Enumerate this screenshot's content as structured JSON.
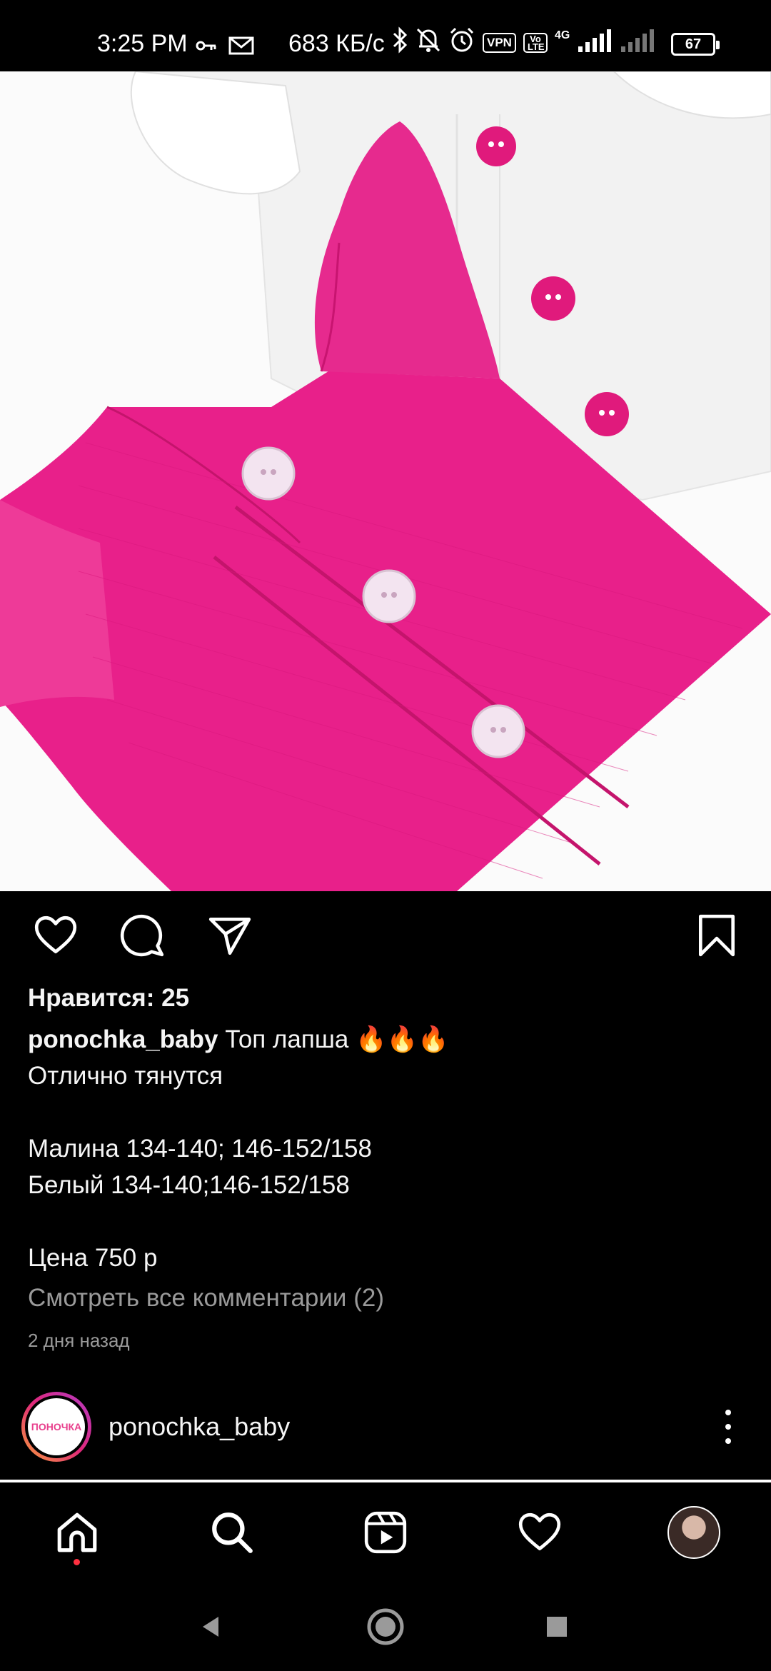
{
  "status_bar": {
    "time": "3:25 PM",
    "speed": "683 КБ/с",
    "vpn": "VPN",
    "volte": "Vo LTE",
    "network": "4G",
    "battery": "67"
  },
  "post": {
    "likes": "Нравится: 25",
    "username": "ponochka_baby",
    "caption_first": "Топ лапша 🔥🔥🔥",
    "caption_rest": "Отлично тянутся\n\nМалина 134-140; 146-152/158\nБелый 134-140;146-152/158\n\nЦена 750 р",
    "view_comments": "Смотреть все комментарии (2)",
    "time_ago": "2 дня назад"
  },
  "next_post": {
    "username": "ponochka_baby",
    "avatar_text": "ПОНОЧКА"
  },
  "colors": {
    "background": "#000000",
    "top_pink": "#e8208a",
    "muted_text": "#9a9a9a",
    "notification_dot": "#ff3040"
  },
  "icons": {
    "like": "heart-icon",
    "comment": "comment-icon",
    "share": "send-icon",
    "save": "bookmark-icon",
    "home": "home-icon",
    "search": "search-icon",
    "reels": "reels-icon",
    "activity": "heart-icon",
    "more": "more-vertical-icon"
  }
}
